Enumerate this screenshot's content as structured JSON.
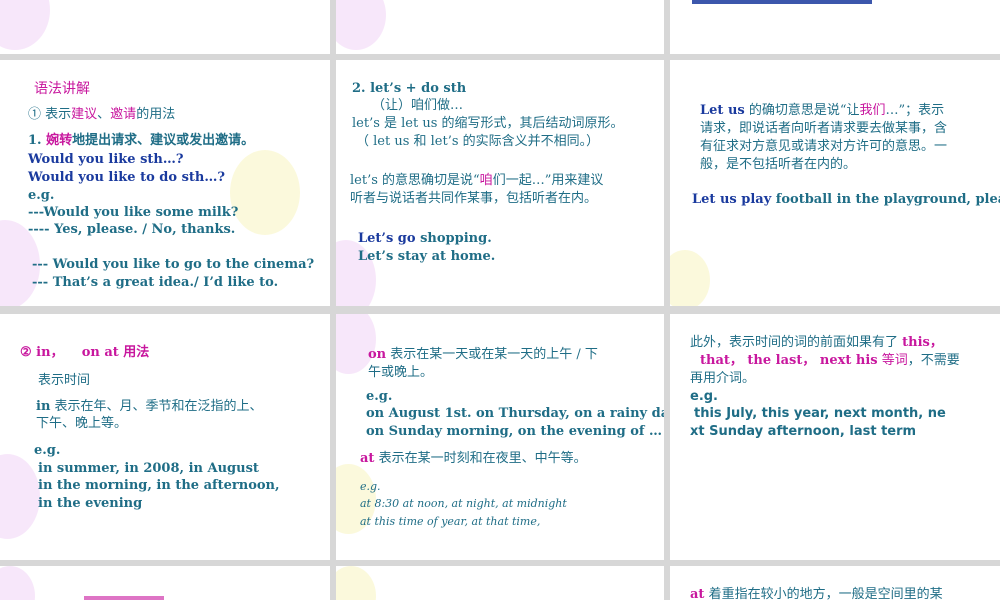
{
  "s1": {
    "title": "语法讲解",
    "sub_prefix": "① 表示",
    "sub_a": "建议",
    "sub_sep": "、",
    "sub_b": "邀请",
    "sub_suffix": "的用法",
    "l1_prefix": "1. ",
    "l1_mag": "婉转",
    "l1_rest": "地提出请求、建议或发出邀请。",
    "l2": "Would you like sth…?",
    "l3": "Would you like to do sth…?",
    "l4": "e.g.",
    "l5": " ---Would you like some milk?",
    "l6": " ---- Yes, please. / No, thanks.",
    "l7": "--- Would you like to go to the cinema?",
    "l8": "--- That’s a great idea./ I’d like to."
  },
  "s2": {
    "l1": "2. let’s + do sth",
    "l2": "（让）咱们做…",
    "l3": " let’s 是 let us 的缩写形式，其后结动词原形。",
    "l4": "（ let us 和   let’s  的实际含义并不相同。）",
    "l5a": "let’s  的意思确切是说“",
    "l5b": "咱",
    "l5c": "们一起…”用来建议",
    "l6": "听者与说话者共同作某事，包括听者在内。",
    "l7a": "Let’s go",
    "l7b": " shopping.",
    "l8": "Let’s stay at home."
  },
  "s3": {
    "l1a": "Let us",
    "l1b": " 的确切意思是说“让",
    "l1c": "我们",
    "l1d": "…”；表示",
    "l2": "请求，即说话者向听者请求要去做某事，含",
    "l3": "有征求对方意见或请求对方许可的意思。一",
    "l4": "般，是不包括听者在内的。",
    "l5a": "Let us play",
    "l5b": " football in the playground, please."
  },
  "s4": {
    "l1a": "② in，",
    "l1b": "on  at  用法",
    "l2": "表示时间",
    "l3a": "in",
    "l3b": "  表示在年、月、季节和在泛指的上、",
    "l4": "下午、晚上等。",
    "l5": "e.g.",
    "l6": "in summer, in 2008,  in August",
    "l7": "in the morning,  in the afternoon,",
    "l8": "in the evening"
  },
  "s5": {
    "l1a": "on",
    "l1b": "  表示在某一天或在某一天的上午 / 下",
    "l2": "午或晚上。",
    "l3": "e.g.",
    "l4": "on August 1st.  on Thursday,  on a rainy day,",
    "l5": " on Sunday morning,  on the evening of …",
    "l6a": "at",
    "l6b": " 表示在某一时刻和在夜里、中午等。",
    "l7": "e.g.",
    "l8": "at 8:30  at noon, at night,  at midnight",
    "l9": "at this time of year,  at that time,"
  },
  "s6": {
    "l1a": "此外，表示时间的词的前面如果有了 ",
    "l1b": "this，",
    "l2a": "that，  the last，  next his",
    "l2b": " 等词",
    "l2c": "，不需要",
    "l3": "再用介词。",
    "l4": "e.g.",
    "l5": "this July, this year, next month,  ne",
    "l6": "xt Sunday afternoon, last term"
  },
  "s9": {
    "l1a": "at",
    "l1b": " 着重指在较小的地方，一般是空间里的某"
  }
}
